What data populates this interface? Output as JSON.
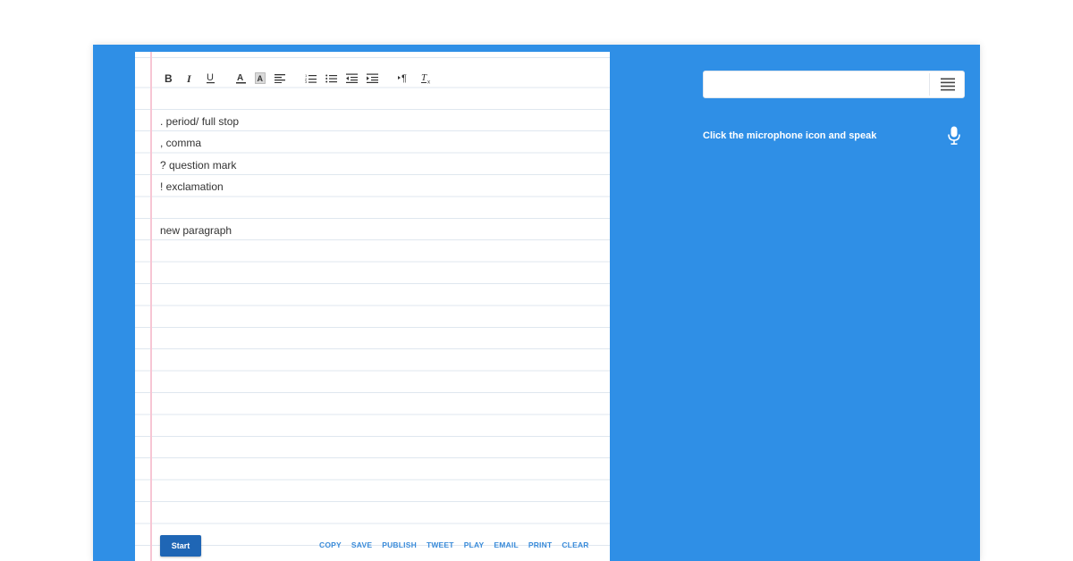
{
  "document": {
    "lines": [
      ". period/ full stop",
      ", comma",
      "? question mark",
      "! exclamation",
      "",
      "new paragraph"
    ]
  },
  "actions": {
    "start_label": "Start",
    "links": [
      "COPY",
      "SAVE",
      "PUBLISH",
      "TWEET",
      "PLAY",
      "EMAIL",
      "PRINT",
      "CLEAR"
    ]
  },
  "search": {
    "value": "",
    "placeholder": ""
  },
  "hint": {
    "text": "Click the microphone icon and speak"
  },
  "toolbar": {
    "icons": [
      "bold-icon",
      "italic-icon",
      "underline-icon",
      "text-color-icon",
      "highlight-icon",
      "align-left-icon",
      "ordered-list-icon",
      "bullet-list-icon",
      "outdent-icon",
      "indent-icon",
      "paragraph-direction-icon",
      "clear-format-icon"
    ]
  },
  "colors": {
    "background": "#2f8fe6",
    "paper": "#ffffff",
    "rule_line": "#dfe7ef",
    "margin_line": "#f7c6d4",
    "start_button": "#1f66b5",
    "action_link": "#3a8bd9"
  }
}
